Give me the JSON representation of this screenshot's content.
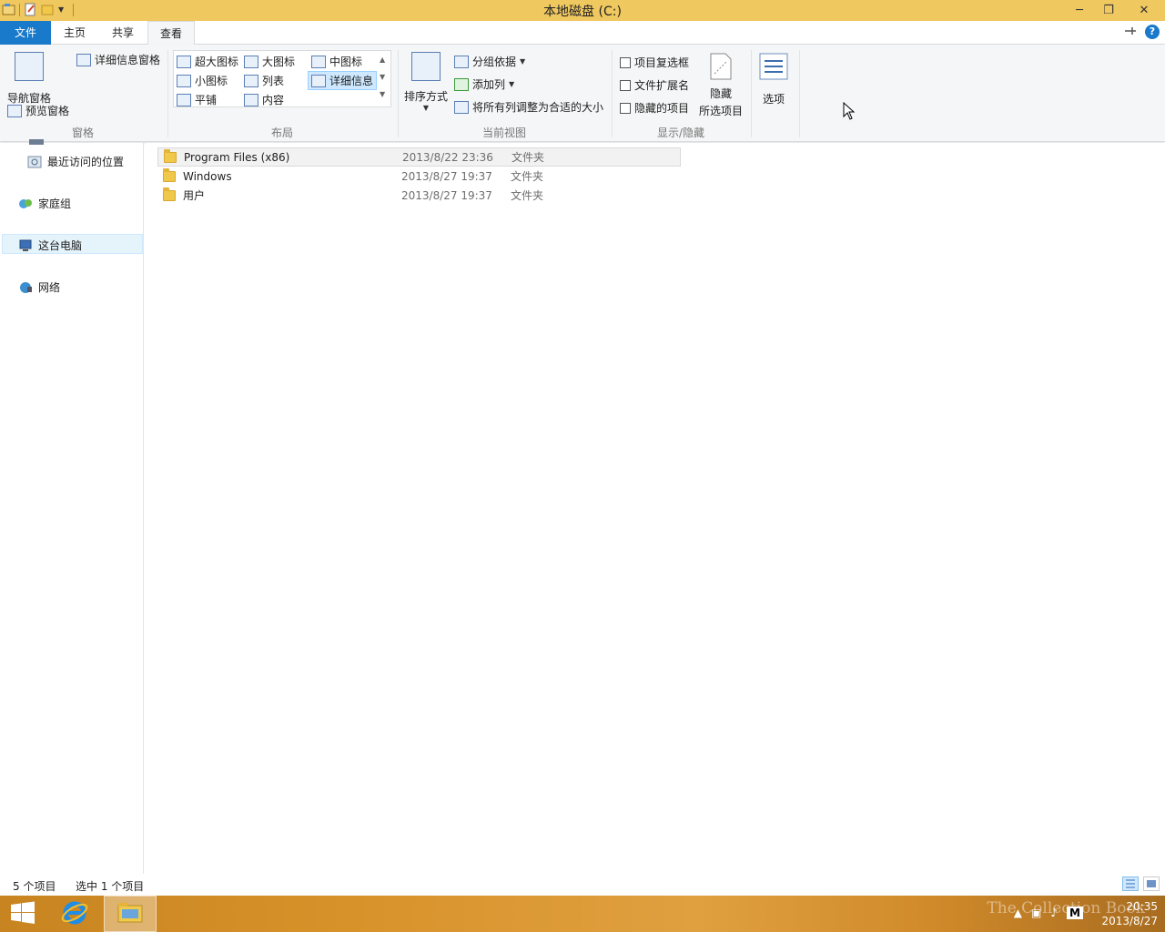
{
  "window": {
    "title": "本地磁盘 (C:)",
    "minimize": "─",
    "restore": "❐",
    "close": "✕"
  },
  "tabs": {
    "file": "文件",
    "home": "主页",
    "share": "共享",
    "view": "查看"
  },
  "ribbon": {
    "panes": {
      "nav_pane": "导航窗格",
      "preview_pane": "预览窗格",
      "details_pane": "详细信息窗格",
      "group_label": "窗格"
    },
    "layout": {
      "extra_large": "超大图标",
      "large": "大图标",
      "medium": "中图标",
      "small": "小图标",
      "list": "列表",
      "details": "详细信息",
      "tiles": "平铺",
      "content": "内容",
      "group_label": "布局"
    },
    "current_view": {
      "sort_by": "排序方式",
      "group_by": "分组依据",
      "add_columns": "添加列",
      "size_all_columns": "将所有列调整为合适的大小",
      "group_label": "当前视图"
    },
    "show_hide": {
      "item_checkboxes": "项目复选框",
      "file_extensions": "文件扩展名",
      "hidden_items": "隐藏的项目",
      "hide_selected_1": "隐藏",
      "hide_selected_2": "所选项目",
      "group_label": "显示/隐藏"
    },
    "options": "选项"
  },
  "nav": {
    "recent": "最近访问的位置",
    "homegroup": "家庭组",
    "this_pc": "这台电脑",
    "network": "网络"
  },
  "files": [
    {
      "name": "Program Files (x86)",
      "date": "2013/8/22 23:36",
      "type": "文件夹"
    },
    {
      "name": "Windows",
      "date": "2013/8/27 19:37",
      "type": "文件夹"
    },
    {
      "name": "用户",
      "date": "2013/8/27 19:37",
      "type": "文件夹"
    }
  ],
  "status": {
    "count": "5 个项目",
    "selected": "选中 1 个项目"
  },
  "taskbar": {
    "time": "20:35",
    "date": "2013/8/27",
    "watermark": "The Collection Book",
    "ime": "M"
  },
  "colors": {
    "titlebar": "#f0c860",
    "accent": "#1979ca",
    "taskbar": "#d8922a"
  }
}
